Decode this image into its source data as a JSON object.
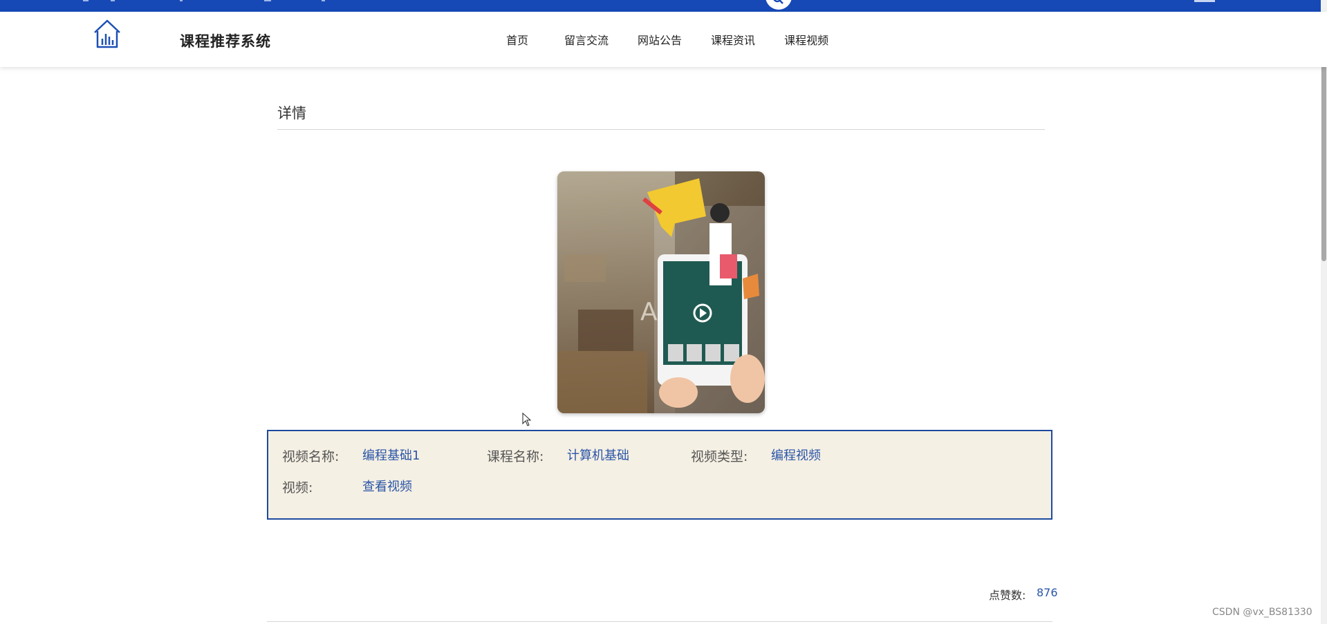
{
  "header": {
    "site_title": "课程推荐系统",
    "nav": [
      "首页",
      "留言交流",
      "网站公告",
      "课程资讯",
      "课程视频"
    ],
    "logo_icon": "home-chart-icon",
    "search_icon": "search-icon"
  },
  "detail": {
    "section_title": "详情",
    "fields": {
      "video_name_label": "视频名称:",
      "video_name_value": "编程基础1",
      "course_name_label": "课程名称:",
      "course_name_value": "计算机基础",
      "video_type_label": "视频类型:",
      "video_type_value": "编程视频",
      "video_label": "视频:",
      "video_link": "查看视频"
    },
    "likes_label": "点赞数:",
    "likes_value": "876"
  },
  "watermark": "CSDN @vx_BS81330",
  "colors": {
    "brand_blue": "#1649b6",
    "link_blue": "#2a55a8",
    "info_bg": "#f5f0e4",
    "info_border": "#1d4a9e"
  }
}
